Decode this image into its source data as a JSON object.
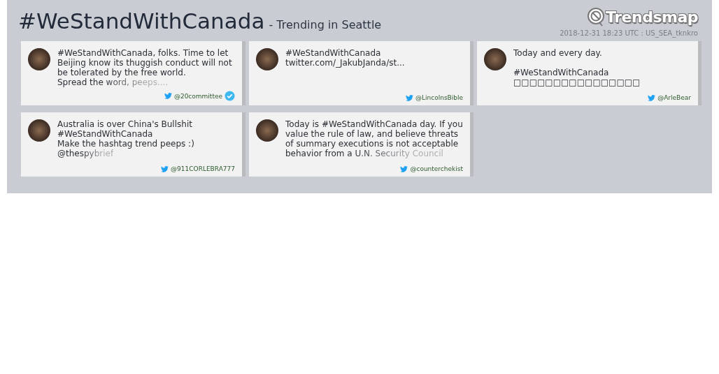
{
  "header": {
    "hashtag": "#WeStandWithCanada",
    "subtitle": "- Trending in Seattle",
    "logo": "Trendsmap",
    "meta": "2018-12-31 18:23 UTC : US_SEA_tknkro"
  },
  "tweets": [
    {
      "text": "#WeStandWithCanada, folks. Time to let\nBeijing know its thuggish conduct will not\nbe tolerated by the free world.\nSpread the word, peeps....",
      "handle": "@20committee",
      "verified": true,
      "faded": true
    },
    {
      "text": "#WeStandWithCanada\ntwitter.com/_JakubJanda/st...",
      "handle": "@LincolnsBible",
      "verified": false,
      "faded": false
    },
    {
      "text": "Today and every day.\n\n#WeStandWithCanada\n□□□□□□□□□□□□□□□□",
      "handle": "@ArleBear",
      "verified": false,
      "faded": false
    },
    {
      "text": "Australia is over China's Bullshit\n#WeStandWithCanada\nMake the hashtag trend peeps :)\n@thespybrief",
      "handle": "@911CORLEBRA777",
      "verified": false,
      "faded": true
    },
    {
      "text": "Today is #WeStandWithCanada day. If you\nvalue the rule of law, and believe threats\nof summary executions is not acceptable\nbehavior from a U.N. Security Council",
      "handle": "@counterchekist",
      "verified": false,
      "faded": true
    }
  ]
}
